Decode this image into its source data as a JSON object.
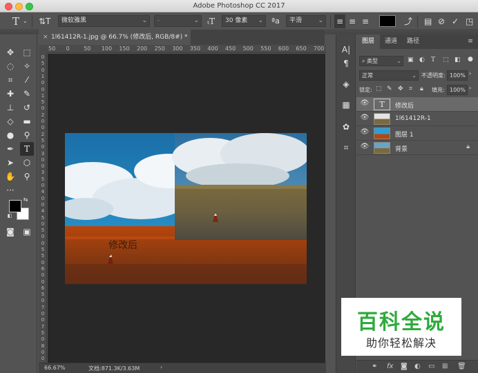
{
  "window": {
    "title": "Adobe Photoshop CC 2017"
  },
  "options_bar": {
    "tool_icon": "type-tool-icon",
    "font_family": "微软雅黑",
    "font_style": "-",
    "font_size": "30 像素",
    "antialias": "平滑",
    "text_color": "#000000"
  },
  "document": {
    "tab_label": "1l61412R-1.jpg @ 66.7% (修改后, RGB/8#) *",
    "close_symbol": "×",
    "ruler_h": [
      "50",
      "0",
      "50",
      "100",
      "150",
      "200",
      "250",
      "300",
      "350",
      "400",
      "450",
      "500",
      "550",
      "600",
      "650",
      "700"
    ],
    "ruler_v": [
      "0",
      "5",
      "0",
      "1",
      "0",
      "0",
      "1",
      "5",
      "0",
      "2",
      "0",
      "0",
      "2",
      "5",
      "0",
      "3",
      "0",
      "0",
      "3",
      "5",
      "0",
      "4",
      "0",
      "0",
      "4",
      "5",
      "0",
      "5",
      "0",
      "0",
      "5",
      "5",
      "0",
      "6",
      "0",
      "0",
      "6",
      "5",
      "0",
      "7",
      "0",
      "0",
      "7",
      "5",
      "0",
      "8",
      "0",
      "0"
    ],
    "text_layer_content": "修改后"
  },
  "status": {
    "zoom": "66.67%",
    "doc_info": "文档:871.3K/3.63M"
  },
  "layers_panel": {
    "tabs": [
      "图层",
      "通道",
      "路径"
    ],
    "filter_kind": "类型",
    "blend_mode": "正常",
    "opacity_label": "不透明度:",
    "opacity_value": "100%",
    "lock_label": "锁定:",
    "fill_label": "填充:",
    "fill_value": "100%",
    "layers": [
      {
        "name": "修改后",
        "type": "text",
        "selected": true
      },
      {
        "name": "1l61412R-1",
        "type": "image",
        "selected": false
      },
      {
        "name": "图层 1",
        "type": "image",
        "selected": false
      },
      {
        "name": "背景",
        "type": "background",
        "selected": false
      }
    ]
  },
  "watermark": {
    "line1": "百科全说",
    "line2": "助你轻松解决"
  }
}
